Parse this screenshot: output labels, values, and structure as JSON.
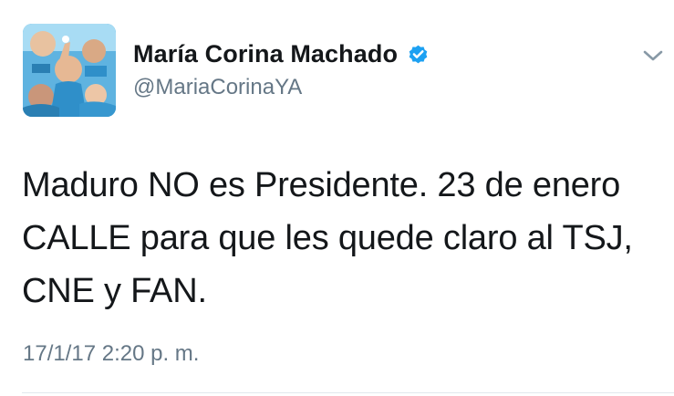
{
  "tweet": {
    "author": {
      "display_name": "María Corina Machado",
      "handle": "@MariaCorinaYA",
      "verified": true
    },
    "text": "Maduro NO es Presidente. 23 de enero\nCALLE para que les quede claro al TSJ,\nCNE y FAN.",
    "timestamp": "17/1/17 2:20 p. m."
  },
  "icons": {
    "verified": "verified-badge-icon",
    "menu": "chevron-down-icon"
  },
  "colors": {
    "name": "#14171a",
    "secondary": "#657786",
    "verified": "#1da1f2",
    "divider": "#e1e8ed"
  }
}
